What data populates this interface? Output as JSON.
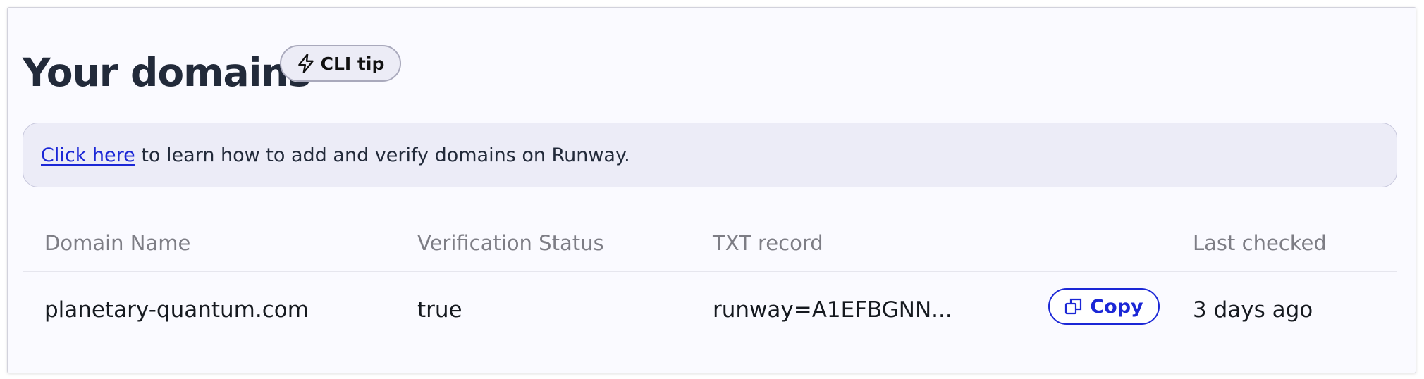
{
  "header": {
    "title": "Your domains",
    "cli_tip_label": "CLI tip",
    "cli_tip_icon": "lightning-icon"
  },
  "banner": {
    "link_text": "Click here",
    "text": " to learn how to add and verify domains on Runway."
  },
  "table": {
    "columns": [
      "Domain Name",
      "Verification Status",
      "TXT record",
      "Last checked"
    ],
    "rows": [
      {
        "domain": "planetary-quantum.com",
        "status": "true",
        "txt": "runway=A1EFBGNN...",
        "copy_label": "Copy",
        "copy_icon": "copy-icon",
        "last_checked": "3 days ago"
      }
    ]
  },
  "colors": {
    "accent": "#1b27d6",
    "title": "#222a3a",
    "muted": "#7d7d85",
    "banner_bg": "#ececf7",
    "card_bg": "#fafaff"
  }
}
